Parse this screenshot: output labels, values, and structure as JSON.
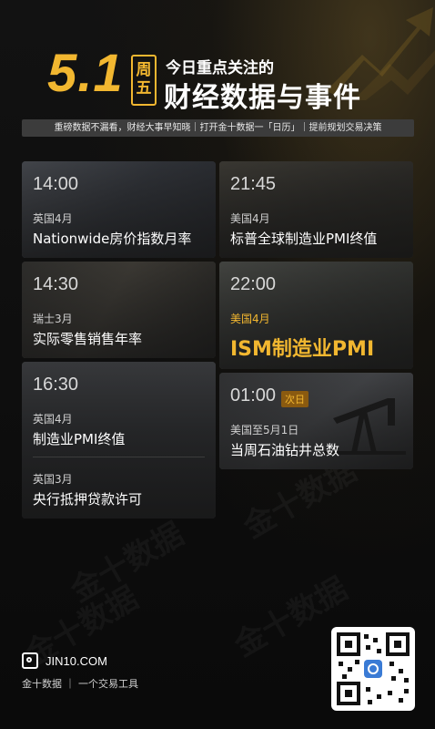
{
  "header": {
    "date": "5.1",
    "weekday": [
      "周",
      "五"
    ],
    "headline_small": "今日重点关注的",
    "headline_big": "财经数据与事件",
    "tagline": "重磅数据不漏看，财经大事早知晓｜打开金十数据一「日历」｜提前规划交易决策"
  },
  "events": [
    {
      "time": "14:00",
      "country": "英国4月",
      "title": "Nationwide房价指数月率"
    },
    {
      "time": "21:45",
      "country": "美国4月",
      "title": "标普全球制造业PMI终值"
    },
    {
      "time": "14:30",
      "country": "瑞士3月",
      "title": "实际零售销售年率"
    },
    {
      "time": "22:00",
      "country": "美国4月",
      "title": "ISM制造业PMI"
    },
    {
      "time": "16:30",
      "country": "英国4月",
      "title": "制造业PMI终值",
      "country2": "英国3月",
      "title2": "央行抵押贷款许可"
    },
    {
      "time": "01:00",
      "badge": "次日",
      "country": "美国至5月1日",
      "title": "当周石油钻井总数"
    }
  ],
  "footer": {
    "site": "JIN10.COM",
    "slogan": "金十数据 ｜ 一个交易工具"
  },
  "watermark": "金十数据",
  "colors": {
    "accent": "#f2b730",
    "background": "#0d0d0d",
    "card": "#2a2a2c"
  }
}
